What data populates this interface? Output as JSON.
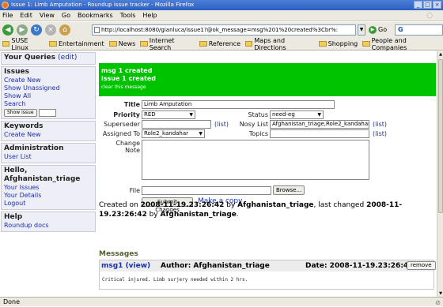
{
  "window": {
    "title": "Issue 1: Limb Amputation - Roundup issue tracker - Mozilla Firefox"
  },
  "menubar": {
    "items": [
      "File",
      "Edit",
      "View",
      "Go",
      "Bookmarks",
      "Tools",
      "Help"
    ]
  },
  "navbar": {
    "url": "http://localhost:8080/gianluca/issue1?@ok_message=msg%201%20created%3Cbr%:",
    "go_label": "Go",
    "search_text": "G"
  },
  "bookmarks": [
    "SUSE Linux",
    "Entertainment",
    "News",
    "Internet Search",
    "Reference",
    "Maps and Directions",
    "Shopping",
    "People and Companies"
  ],
  "sidebar": {
    "queries_title": "Your Queries",
    "queries_edit": "(edit)",
    "issues_title": "Issues",
    "issues_links": [
      "Create New",
      "Show Unassigned",
      "Show All",
      "Search"
    ],
    "show_issue_button": "Show issue",
    "keywords_title": "Keywords",
    "keywords_links": [
      "Create New"
    ],
    "admin_title": "Administration",
    "admin_links": [
      "User List"
    ],
    "hello_title": "Hello, Afghanistan_triage",
    "hello_links": [
      "Your Issues",
      "Your Details",
      "Logout"
    ],
    "help_title": "Help",
    "help_links": [
      "Roundup docs"
    ]
  },
  "notice": {
    "line1": "msg 1 created",
    "line2": "issue 1 created",
    "clear": "clear this message"
  },
  "form": {
    "title_label": "Title",
    "title_value": "Limb Amputation",
    "priority_label": "Priority",
    "priority_value": "RED",
    "status_label": "Status",
    "status_value": "need-eg",
    "superseder_label": "Superseder",
    "superseder_value": "",
    "list_label": "(list)",
    "nosy_label": "Nosy List",
    "nosy_value": "Afghanistan_triage,Role2_kandahar",
    "assigned_label": "Assigned To",
    "assigned_value": "Role2_kandahar",
    "topics_label": "Topics",
    "topics_value": "",
    "change_note_label": "Change Note",
    "file_label": "File",
    "browse_label": "Browse...",
    "submit_label": "Submit Changes",
    "copy_label": "Make a copy"
  },
  "created": {
    "prefix": "Created on",
    "created_date": "2008-11-19.23:26:42",
    "by1": "by",
    "creator": "Afghanistan_triage",
    "mid": ", last changed",
    "changed_date": "2008-11-19.23:26:42",
    "by2": "by",
    "changer": "Afghanistan_triage",
    "end": "."
  },
  "messages": {
    "title": "Messages",
    "rows": [
      {
        "link": "msg1 (view)",
        "author": "Author: Afghanistan_triage",
        "date": "Date: 2008-11-19.23:26:42",
        "remove": "remove",
        "body": "Critical injured. Limb surjery needed within 2 hrs."
      }
    ]
  },
  "status": {
    "text": "Done"
  },
  "colors": {
    "notice_bg": "#00c300",
    "link": "#1a30b0",
    "messages_title": "#506030"
  }
}
